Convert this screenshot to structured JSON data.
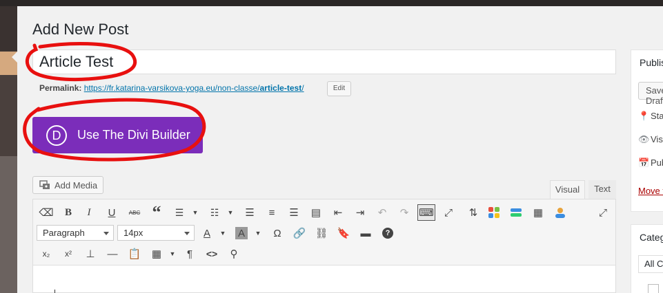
{
  "page": {
    "title": "Add New Post"
  },
  "post": {
    "title": "Article Test",
    "permalink_label": "Permalink:",
    "permalink_base": "https://fr.katarina-varsikova-yoga.eu/non-classe/",
    "permalink_slug": "article-test",
    "permalink_trailing": "/",
    "edit_label": "Edit"
  },
  "divi": {
    "logo_letter": "D",
    "label": "Use The Divi Builder",
    "color": "#7b2dba"
  },
  "editor": {
    "add_media_label": "Add Media",
    "tabs": {
      "visual": "Visual",
      "text": "Text"
    },
    "format_select": "Paragraph",
    "size_select": "14px"
  },
  "publish": {
    "title": "Publish",
    "save_label": "Save Draft",
    "status_label": "Status: Draft",
    "visibility_label": "Visibility: Public",
    "publish_label": "Publish immediately",
    "move_label": "Move to Trash"
  },
  "categories": {
    "title": "Categories",
    "tab_all": "All Categories"
  },
  "colors": {
    "accent": "#0073aa",
    "annotation": "#e8100f",
    "trash": "#a00"
  }
}
